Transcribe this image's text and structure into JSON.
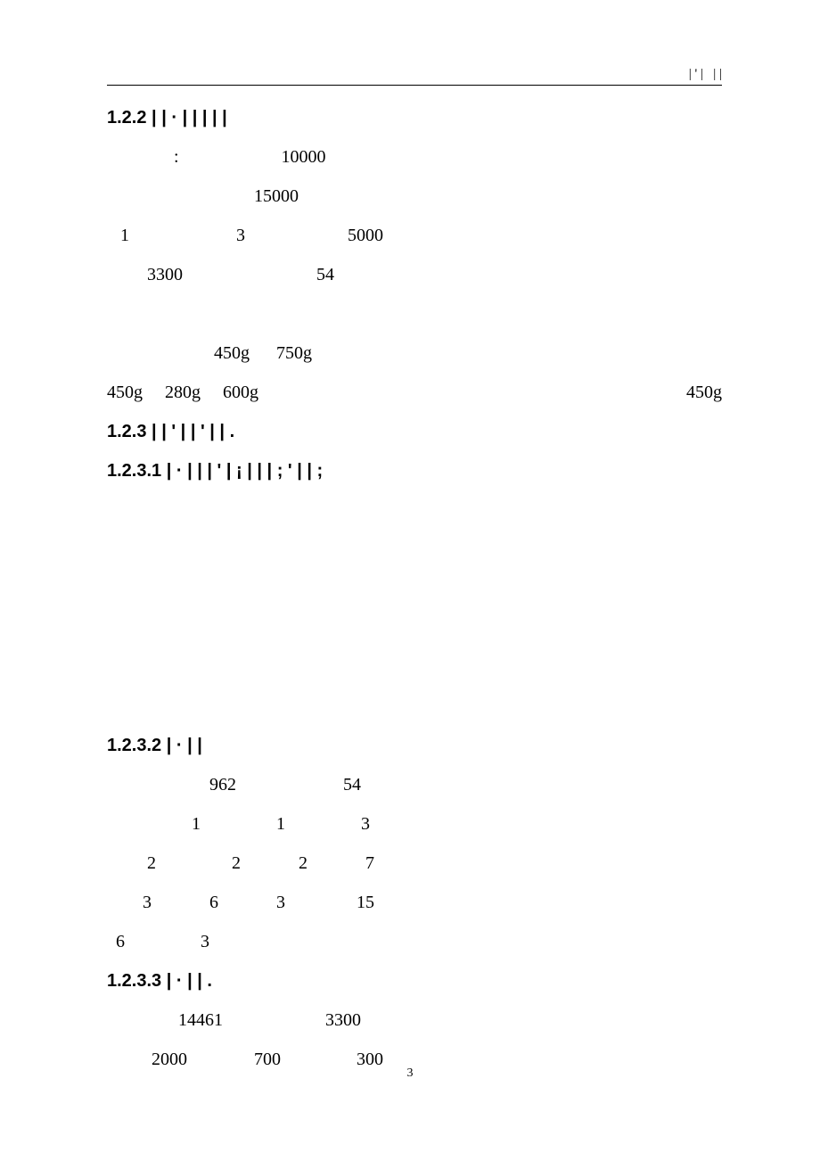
{
  "header": {
    "text": "| ' |   | |"
  },
  "sections": {
    "s122": {
      "number": "1.2.2",
      "title": "| |   ·  | |  |  |  |",
      "para1": "       :                       10000",
      "para2": "                         15000",
      "para3": "   1                        3                       5000",
      "para4": "         3300                              54",
      "para5": " ",
      "para6": "                        450g      750g",
      "para7_left": "450g     280g     600g",
      "para7_right": "450g"
    },
    "s123": {
      "number": "1.2.3",
      "title": "|  |  '  |  |  '   |  |  ."
    },
    "s1231": {
      "number": "1.2.3.1",
      "title": "|   ·  |  |  |  '   |  ¡  |  |  |  ;  '  |  |  ;"
    },
    "s1232": {
      "number": "1.2.3.2",
      "title": "|  ·  |  |",
      "para1": "                       962                        54",
      "para2": "                   1                 1                 3",
      "para3": "         2                 2             2             7",
      "para4": "        3             6             3                15",
      "para5": "  6                 3"
    },
    "s1233": {
      "number": "1.2.3.3",
      "title": "|   ·  |  |  .",
      "para1": "                14461                       3300",
      "para2": "          2000               700                 300"
    }
  },
  "pageNumber": "3"
}
